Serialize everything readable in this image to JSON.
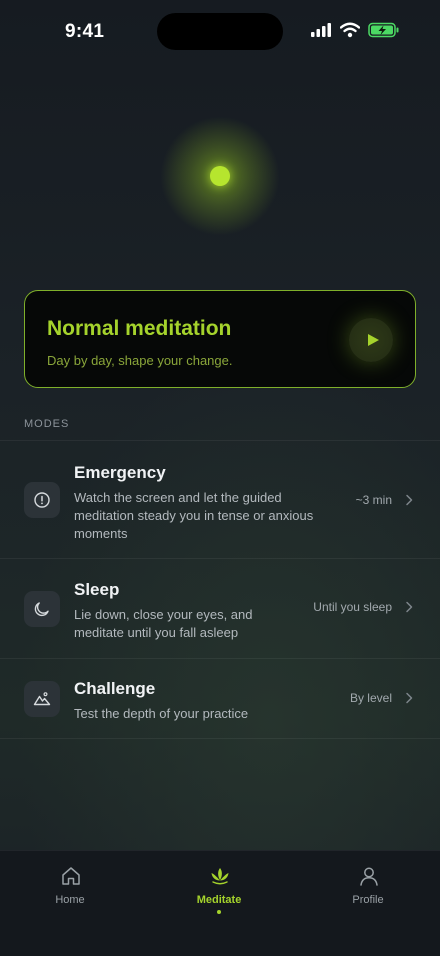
{
  "status_bar": {
    "time": "9:41"
  },
  "hero": {
    "title": "Normal meditation",
    "subtitle": "Day by day, shape your change."
  },
  "modes": {
    "section_label": "MODES",
    "items": [
      {
        "title": "Emergency",
        "description": "Watch the screen and let the guided meditation steady you in tense or anxious moments",
        "meta": "~3 min",
        "icon": "alert-circle-icon"
      },
      {
        "title": "Sleep",
        "description": "Lie down, close your eyes, and meditate until you fall asleep",
        "meta": "Until you sleep",
        "icon": "moon-icon"
      },
      {
        "title": "Challenge",
        "description": "Test the depth of your practice",
        "meta": "By level",
        "icon": "mountain-icon"
      }
    ]
  },
  "nav": {
    "items": [
      {
        "label": "Home",
        "icon": "home-icon"
      },
      {
        "label": "Meditate",
        "icon": "lotus-icon",
        "active": true
      },
      {
        "label": "Profile",
        "icon": "user-icon"
      }
    ]
  },
  "colors": {
    "accent": "#a5d32c",
    "background": "#15191d",
    "card_bg": "#060807"
  }
}
